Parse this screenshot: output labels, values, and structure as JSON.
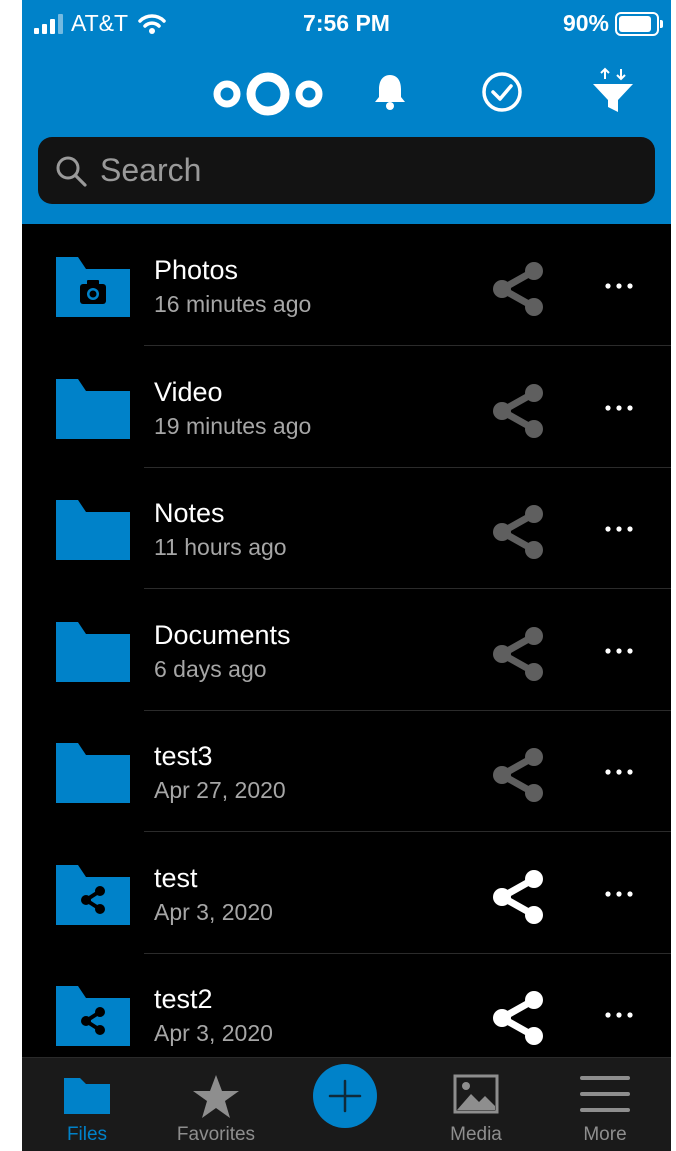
{
  "status_bar": {
    "carrier": "AT&T",
    "time": "7:56 PM",
    "battery": "90%"
  },
  "header": {
    "logo_icon": "nextcloud-logo",
    "actions": [
      "bell-icon",
      "check-circle-icon",
      "sort-filter-icon"
    ]
  },
  "search": {
    "placeholder": "Search"
  },
  "files": [
    {
      "name": "Photos",
      "modified": "16 minutes ago",
      "icon": "folder-camera-icon",
      "shared": false
    },
    {
      "name": "Video",
      "modified": "19 minutes ago",
      "icon": "folder-icon",
      "shared": false
    },
    {
      "name": "Notes",
      "modified": "11 hours ago",
      "icon": "folder-icon",
      "shared": false
    },
    {
      "name": "Documents",
      "modified": "6 days ago",
      "icon": "folder-icon",
      "shared": false
    },
    {
      "name": "test3",
      "modified": "Apr 27, 2020",
      "icon": "folder-icon",
      "shared": false
    },
    {
      "name": "test",
      "modified": "Apr 3, 2020",
      "icon": "folder-shared-icon",
      "shared": true
    },
    {
      "name": "test2",
      "modified": "Apr 3, 2020",
      "icon": "folder-shared-icon",
      "shared": true
    }
  ],
  "tabs": [
    {
      "label": "Files",
      "icon": "folder-icon",
      "active": true
    },
    {
      "label": "Favorites",
      "icon": "star-icon",
      "active": false
    },
    {
      "label": "Media",
      "icon": "image-icon",
      "active": false
    },
    {
      "label": "More",
      "icon": "menu-icon",
      "active": false
    }
  ],
  "colors": {
    "accent": "#0082c9",
    "background": "#000000",
    "share_inactive": "#5f5f5f",
    "share_active": "#ffffff"
  }
}
